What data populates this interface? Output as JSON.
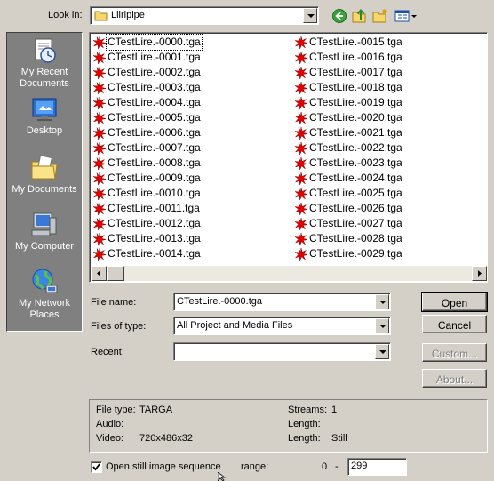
{
  "lookin": {
    "label": "Look in:",
    "folder": "Liiripipe"
  },
  "toolbar": {
    "back_icon": "back-arrow-icon",
    "up_icon": "up-folder-icon",
    "new_folder_icon": "new-folder-icon",
    "views_icon": "views-menu-icon"
  },
  "places": [
    {
      "label": "My Recent Documents",
      "icon": "recent-documents-icon"
    },
    {
      "label": "Desktop",
      "icon": "desktop-icon"
    },
    {
      "label": "My Documents",
      "icon": "my-documents-icon"
    },
    {
      "label": "My Computer",
      "icon": "my-computer-icon"
    },
    {
      "label": "My Network Places",
      "icon": "network-places-icon"
    }
  ],
  "files": {
    "col1": [
      "CTestLire.-0000.tga",
      "CTestLire.-0001.tga",
      "CTestLire.-0002.tga",
      "CTestLire.-0003.tga",
      "CTestLire.-0004.tga",
      "CTestLire.-0005.tga",
      "CTestLire.-0006.tga",
      "CTestLire.-0007.tga",
      "CTestLire.-0008.tga",
      "CTestLire.-0009.tga",
      "CTestLire.-0010.tga",
      "CTestLire.-0011.tga",
      "CTestLire.-0012.tga",
      "CTestLire.-0013.tga",
      "CTestLire.-0014.tga"
    ],
    "col2": [
      "CTestLire.-0015.tga",
      "CTestLire.-0016.tga",
      "CTestLire.-0017.tga",
      "CTestLire.-0018.tga",
      "CTestLire.-0019.tga",
      "CTestLire.-0020.tga",
      "CTestLire.-0021.tga",
      "CTestLire.-0022.tga",
      "CTestLire.-0023.tga",
      "CTestLire.-0024.tga",
      "CTestLire.-0025.tga",
      "CTestLire.-0026.tga",
      "CTestLire.-0027.tga",
      "CTestLire.-0028.tga",
      "CTestLire.-0029.tga"
    ],
    "selected": "CTestLire.-0000.tga",
    "file_icon": "tga-file-icon"
  },
  "form": {
    "filename_label": "File name:",
    "filename_value": "CTestLire.-0000.tga",
    "filetype_label": "Files of type:",
    "filetype_value": "All Project and Media Files",
    "recent_label": "Recent:",
    "recent_value": ""
  },
  "buttons": {
    "open": "Open",
    "cancel": "Cancel",
    "custom": "Custom...",
    "about": "About..."
  },
  "info": {
    "filetype_label": "File type:",
    "filetype_value": "TARGA",
    "audio_label": "Audio:",
    "audio_value": "",
    "video_label": "Video:",
    "video_value": "720x486x32",
    "streams_label": "Streams:",
    "streams_value": "1",
    "length1_label": "Length:",
    "length1_value": "",
    "length2_label": "Length:",
    "length2_value": "Still"
  },
  "sequence": {
    "checkbox_label": "Open still image sequence",
    "checked": true,
    "range_label": "range:",
    "range_start": "0",
    "range_dash": "-",
    "range_end": "299"
  },
  "colors": {
    "dialog_bg": "#d4d0c8",
    "places_bg": "#808080",
    "file_icon_red": "#e00000"
  }
}
